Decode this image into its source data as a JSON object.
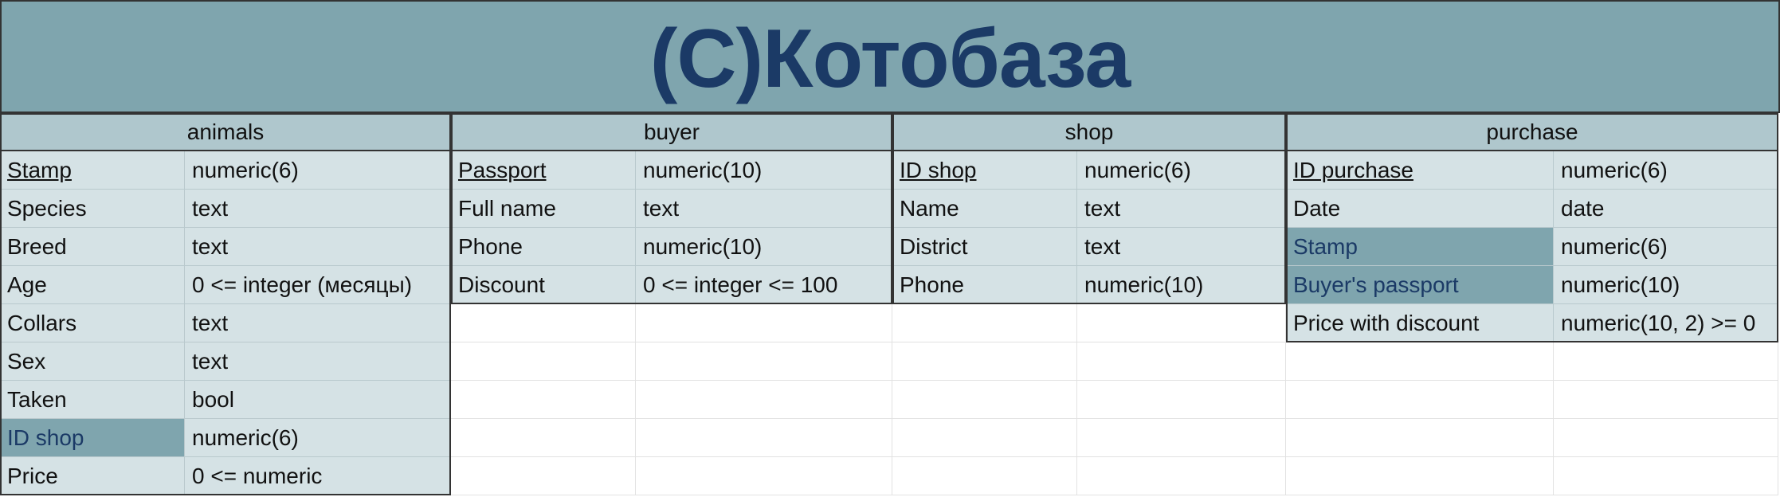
{
  "title": "(С)Котобаза",
  "colors": {
    "title_bg": "#7fa5ae",
    "title_text": "#1b3a66",
    "header_bg": "#afc7cd",
    "cell_bg": "#d5e2e5",
    "foreign_key_bg": "#7fa5ae",
    "foreign_key_text": "#1b3a66"
  },
  "tables": [
    {
      "name": "animals",
      "rows": [
        {
          "field": "Stamp",
          "type": "numeric(6)",
          "primary_key": true
        },
        {
          "field": "Species",
          "type": "text"
        },
        {
          "field": "Breed",
          "type": "text"
        },
        {
          "field": "Age",
          "type": "0 <= integer (месяцы)"
        },
        {
          "field": "Collars",
          "type": "text"
        },
        {
          "field": "Sex",
          "type": "text"
        },
        {
          "field": "Taken",
          "type": "bool"
        },
        {
          "field": "ID shop",
          "type": "numeric(6)",
          "foreign_key": true
        },
        {
          "field": "Price",
          "type": "0 <= numeric"
        }
      ]
    },
    {
      "name": "buyer",
      "rows": [
        {
          "field": "Passport",
          "type": "numeric(10)",
          "primary_key": true
        },
        {
          "field": "Full name",
          "type": "text"
        },
        {
          "field": "Phone",
          "type": "numeric(10)"
        },
        {
          "field": "Discount",
          "type": "0 <= integer <= 100"
        }
      ]
    },
    {
      "name": "shop",
      "rows": [
        {
          "field": "ID shop",
          "type": "numeric(6)",
          "primary_key": true
        },
        {
          "field": "Name",
          "type": "text"
        },
        {
          "field": "District",
          "type": "text"
        },
        {
          "field": "Phone",
          "type": "numeric(10)"
        }
      ]
    },
    {
      "name": "purchase",
      "rows": [
        {
          "field": "ID purchase",
          "type": "numeric(6)",
          "primary_key": true
        },
        {
          "field": "Date",
          "type": "date"
        },
        {
          "field": "Stamp",
          "type": "numeric(6)",
          "foreign_key": true
        },
        {
          "field": "Buyer's passport",
          "type": "numeric(10)",
          "foreign_key": true
        },
        {
          "field": "Price with discount",
          "type": "numeric(10, 2) >= 0"
        }
      ]
    }
  ]
}
